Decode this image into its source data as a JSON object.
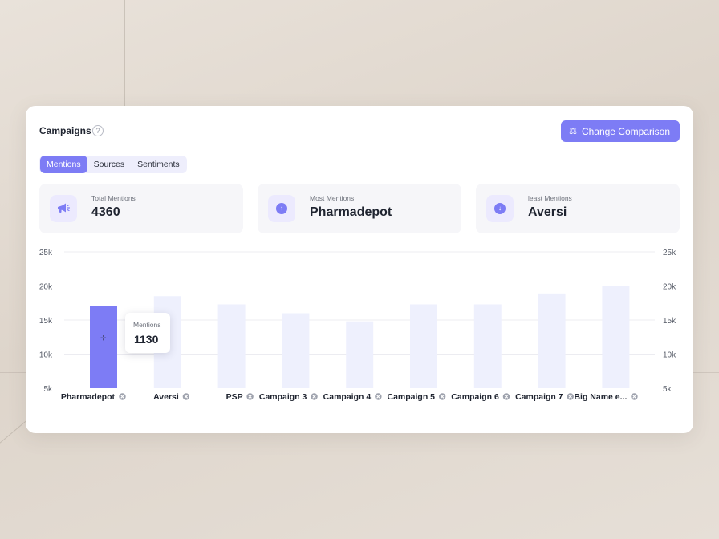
{
  "card": {
    "title": "Campaigns",
    "help_icon": "?",
    "cta_label": "Change Comparison",
    "cta_icon": "⚖"
  },
  "tabs": [
    {
      "label": "Mentions",
      "active": true
    },
    {
      "label": "Sources",
      "active": false
    },
    {
      "label": "Sentiments",
      "active": false
    }
  ],
  "stats": [
    {
      "label": "Total Mentions",
      "value": "4360",
      "icon": "megaphone-icon"
    },
    {
      "label": "Most Mentions",
      "value": "Pharmadepot",
      "icon": "arrow-up-icon",
      "glyph": "↑"
    },
    {
      "label": "least Mentions",
      "value": "Aversi",
      "icon": "arrow-down-icon",
      "glyph": "↓"
    }
  ],
  "tooltip": {
    "label": "Mentions",
    "value": "1130"
  },
  "colors": {
    "accent": "#7d7cf5",
    "bar_muted": "#eef0fd"
  },
  "chart_data": {
    "type": "bar",
    "categories": [
      "Pharmadepot",
      "Aversi",
      "PSP",
      "Campaign 3",
      "Campaign 4",
      "Campaign 5",
      "Campaign 6",
      "Campaign 7",
      "Big Name e..."
    ],
    "values": [
      17000,
      18500,
      17300,
      16000,
      14800,
      17300,
      17300,
      18900,
      20000
    ],
    "highlighted_index": 0,
    "ylim": [
      5000,
      25000
    ],
    "yticks": [
      5000,
      10000,
      15000,
      20000,
      25000
    ],
    "ytick_labels": [
      "5k",
      "10k",
      "15k",
      "20k",
      "25k"
    ],
    "grid": true
  }
}
